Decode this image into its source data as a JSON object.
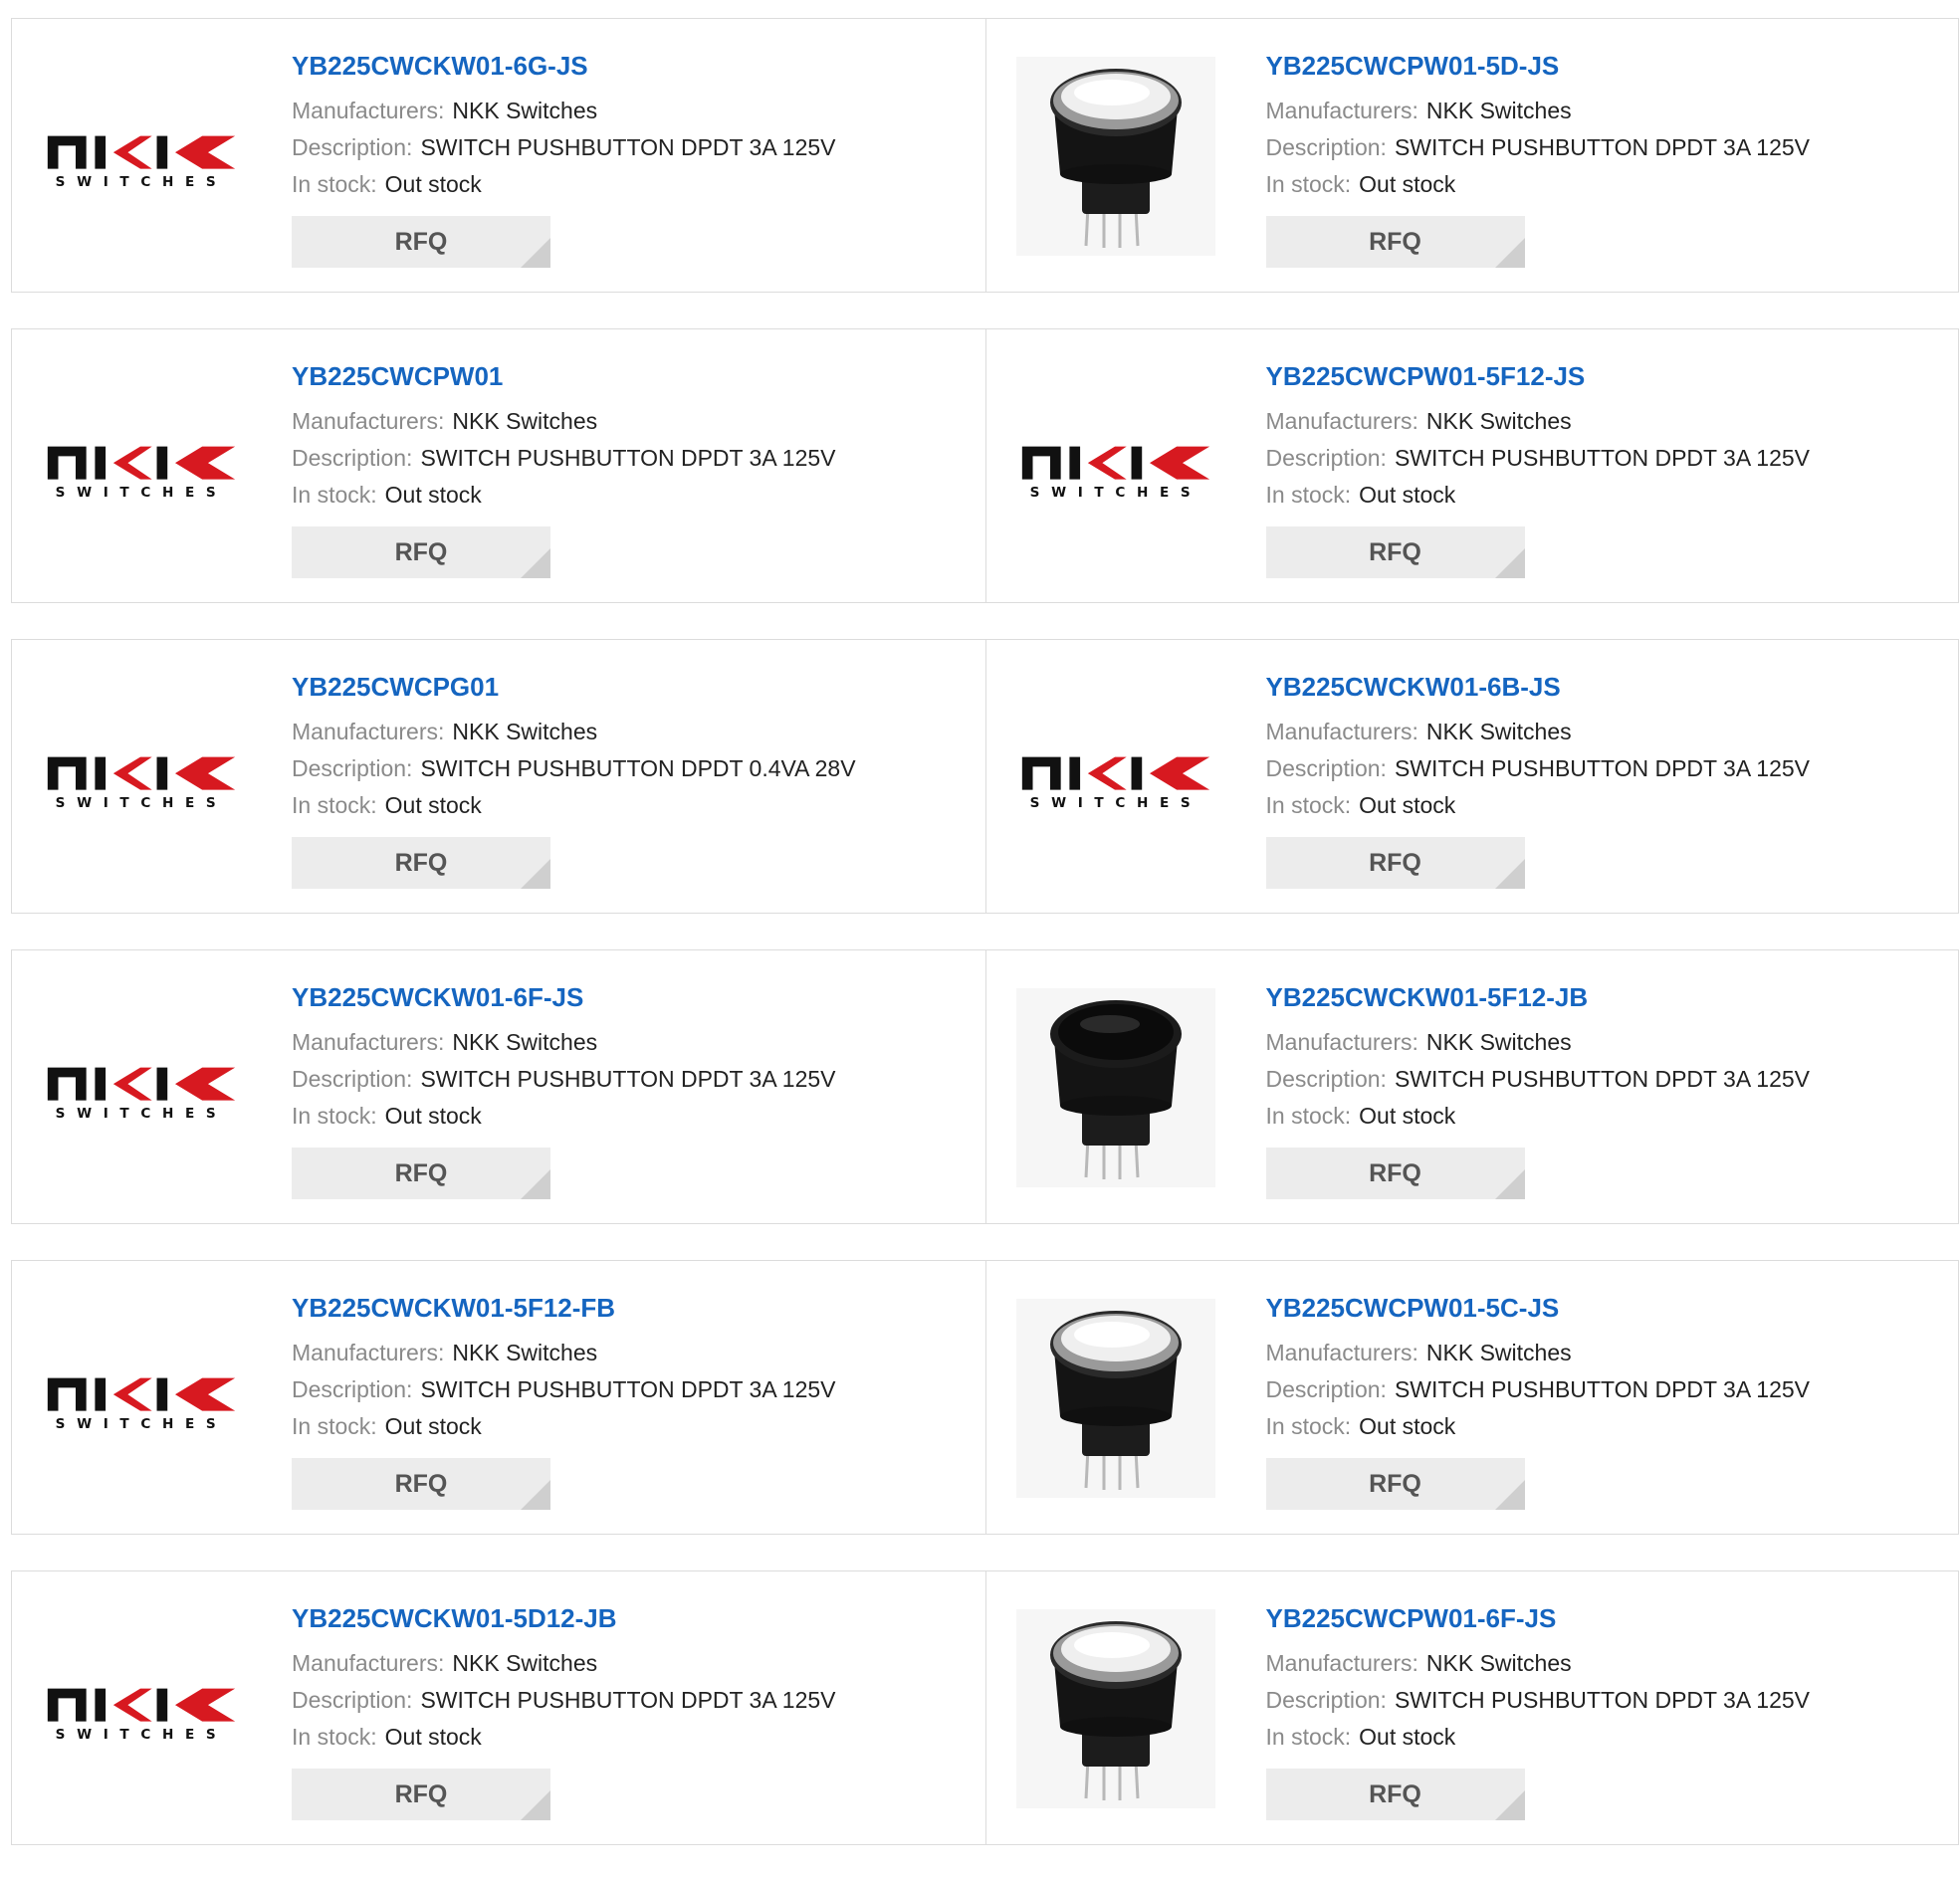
{
  "products": [
    {
      "part": "YB225CWCKW01-6G-JS",
      "image": "nkk-logo-icon",
      "manufacturers_label": "Manufacturers:",
      "manufacturer": "NKK Switches",
      "description_label": "Description:",
      "description": "SWITCH PUSHBUTTON DPDT 3A 125V",
      "stock_label": "In stock:",
      "stock": "Out stock",
      "rfq": "RFQ"
    },
    {
      "part": "YB225CWCPW01-5D-JS",
      "image": "pushbutton-white-icon",
      "manufacturers_label": "Manufacturers:",
      "manufacturer": "NKK Switches",
      "description_label": "Description:",
      "description": "SWITCH PUSHBUTTON DPDT 3A 125V",
      "stock_label": "In stock:",
      "stock": "Out stock",
      "rfq": "RFQ"
    },
    {
      "part": "YB225CWCPW01",
      "image": "nkk-logo-icon",
      "manufacturers_label": "Manufacturers:",
      "manufacturer": "NKK Switches",
      "description_label": "Description:",
      "description": "SWITCH PUSHBUTTON DPDT 3A 125V",
      "stock_label": "In stock:",
      "stock": "Out stock",
      "rfq": "RFQ"
    },
    {
      "part": "YB225CWCPW01-5F12-JS",
      "image": "nkk-logo-icon",
      "manufacturers_label": "Manufacturers:",
      "manufacturer": "NKK Switches",
      "description_label": "Description:",
      "description": "SWITCH PUSHBUTTON DPDT 3A 125V",
      "stock_label": "In stock:",
      "stock": "Out stock",
      "rfq": "RFQ"
    },
    {
      "part": "YB225CWCPG01",
      "image": "nkk-logo-icon",
      "manufacturers_label": "Manufacturers:",
      "manufacturer": "NKK Switches",
      "description_label": "Description:",
      "description": "SWITCH PUSHBUTTON DPDT 0.4VA 28V",
      "stock_label": "In stock:",
      "stock": "Out stock",
      "rfq": "RFQ"
    },
    {
      "part": "YB225CWCKW01-6B-JS",
      "image": "nkk-logo-icon",
      "manufacturers_label": "Manufacturers:",
      "manufacturer": "NKK Switches",
      "description_label": "Description:",
      "description": "SWITCH PUSHBUTTON DPDT 3A 125V",
      "stock_label": "In stock:",
      "stock": "Out stock",
      "rfq": "RFQ"
    },
    {
      "part": "YB225CWCKW01-6F-JS",
      "image": "nkk-logo-icon",
      "manufacturers_label": "Manufacturers:",
      "manufacturer": "NKK Switches",
      "description_label": "Description:",
      "description": "SWITCH PUSHBUTTON DPDT 3A 125V",
      "stock_label": "In stock:",
      "stock": "Out stock",
      "rfq": "RFQ"
    },
    {
      "part": "YB225CWCKW01-5F12-JB",
      "image": "pushbutton-black-icon",
      "manufacturers_label": "Manufacturers:",
      "manufacturer": "NKK Switches",
      "description_label": "Description:",
      "description": "SWITCH PUSHBUTTON DPDT 3A 125V",
      "stock_label": "In stock:",
      "stock": "Out stock",
      "rfq": "RFQ"
    },
    {
      "part": "YB225CWCKW01-5F12-FB",
      "image": "nkk-logo-icon",
      "manufacturers_label": "Manufacturers:",
      "manufacturer": "NKK Switches",
      "description_label": "Description:",
      "description": "SWITCH PUSHBUTTON DPDT 3A 125V",
      "stock_label": "In stock:",
      "stock": "Out stock",
      "rfq": "RFQ"
    },
    {
      "part": "YB225CWCPW01-5C-JS",
      "image": "pushbutton-white-icon",
      "manufacturers_label": "Manufacturers:",
      "manufacturer": "NKK Switches",
      "description_label": "Description:",
      "description": "SWITCH PUSHBUTTON DPDT 3A 125V",
      "stock_label": "In stock:",
      "stock": "Out stock",
      "rfq": "RFQ"
    },
    {
      "part": "YB225CWCKW01-5D12-JB",
      "image": "nkk-logo-icon",
      "manufacturers_label": "Manufacturers:",
      "manufacturer": "NKK Switches",
      "description_label": "Description:",
      "description": "SWITCH PUSHBUTTON DPDT 3A 125V",
      "stock_label": "In stock:",
      "stock": "Out stock",
      "rfq": "RFQ"
    },
    {
      "part": "YB225CWCPW01-6F-JS",
      "image": "pushbutton-white-icon",
      "manufacturers_label": "Manufacturers:",
      "manufacturer": "NKK Switches",
      "description_label": "Description:",
      "description": "SWITCH PUSHBUTTON DPDT 3A 125V",
      "stock_label": "In stock:",
      "stock": "Out stock",
      "rfq": "RFQ"
    }
  ],
  "logo": {
    "text": "SWITCHES",
    "mark_color": "#111111",
    "accent_color": "#d71920"
  },
  "colors": {
    "part_link": "#1565c0",
    "label": "#8a8a8a",
    "value": "#222222",
    "border": "#dcdcdc",
    "button_bg": "#ececec"
  }
}
